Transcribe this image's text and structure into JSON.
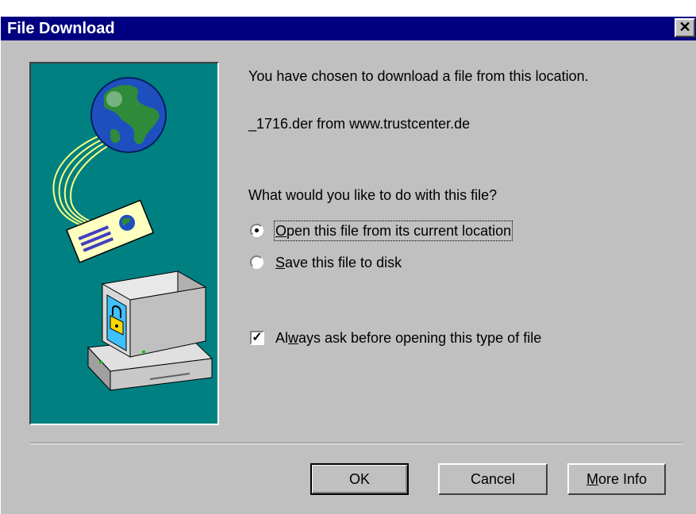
{
  "window": {
    "title": "File Download",
    "close_glyph": "✕"
  },
  "content": {
    "message": "You have chosen to download a file from this location.",
    "file_source": "_1716.der from www.trustcenter.de",
    "question": "What would you like to do with this file?"
  },
  "options": {
    "open": {
      "label_before": "",
      "accel": "O",
      "label_after": "pen this file from its current location",
      "selected": true
    },
    "save": {
      "label_before": "",
      "accel": "S",
      "label_after": "ave this file to disk",
      "selected": false
    }
  },
  "always_ask": {
    "label_before": "Al",
    "accel": "w",
    "label_after": "ays ask before opening this type of file",
    "checked": true
  },
  "buttons": {
    "ok": "OK",
    "cancel": "Cancel",
    "more_info_accel": "M",
    "more_info_rest": "ore Info"
  },
  "icons": {
    "illustration": "globe-download-to-computer-illustration",
    "lock": "padlock-icon"
  }
}
